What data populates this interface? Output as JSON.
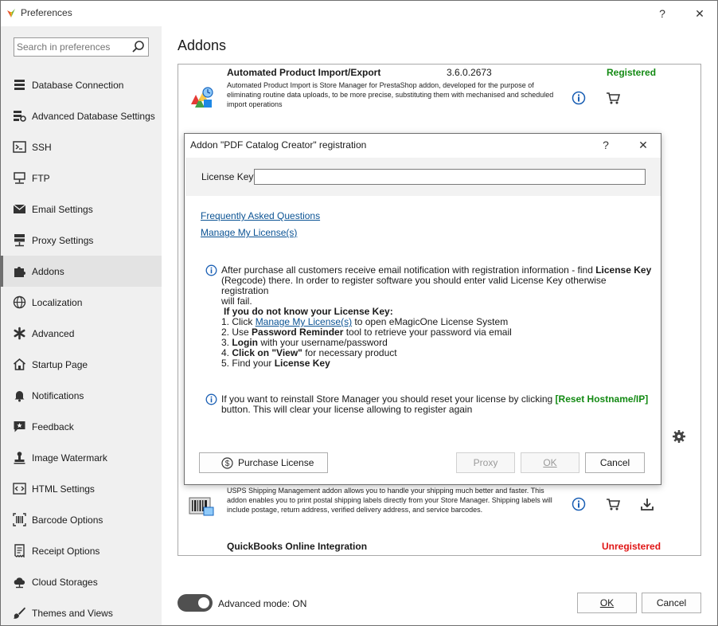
{
  "window": {
    "title": "Preferences",
    "help_glyph": "?",
    "close_glyph": "✕"
  },
  "sidebar": {
    "search_placeholder": "Search in preferences",
    "items": [
      {
        "label": "Database Connection",
        "icon": "database-icon"
      },
      {
        "label": "Advanced Database Settings",
        "icon": "database-settings-icon"
      },
      {
        "label": "SSH",
        "icon": "terminal-icon"
      },
      {
        "label": "FTP",
        "icon": "ftp-icon"
      },
      {
        "label": "Email Settings",
        "icon": "envelope-icon"
      },
      {
        "label": "Proxy Settings",
        "icon": "proxy-icon"
      },
      {
        "label": "Addons",
        "icon": "puzzle-icon",
        "active": true
      },
      {
        "label": "Localization",
        "icon": "globe-icon"
      },
      {
        "label": "Advanced",
        "icon": "asterisk-icon"
      },
      {
        "label": "Startup Page",
        "icon": "home-icon"
      },
      {
        "label": "Notifications",
        "icon": "bell-icon"
      },
      {
        "label": "Feedback",
        "icon": "feedback-icon"
      },
      {
        "label": "Image Watermark",
        "icon": "stamp-icon"
      },
      {
        "label": "HTML Settings",
        "icon": "code-icon"
      },
      {
        "label": "Barcode Options",
        "icon": "barcode-icon"
      },
      {
        "label": "Receipt Options",
        "icon": "receipt-icon"
      },
      {
        "label": "Cloud Storages",
        "icon": "cloud-icon"
      },
      {
        "label": "Themes and Views",
        "icon": "brush-icon"
      }
    ]
  },
  "main": {
    "title": "Addons",
    "addons": [
      {
        "name": "Automated Product Import/Export",
        "version": "3.6.0.2673",
        "status": "Registered",
        "description": "Automated Product Import is Store Manager for PrestaShop addon, developed for the purpose of eliminating routine data uploads, to be more precise, substituting them with mechanised and scheduled import operations"
      },
      {
        "name": "",
        "version": "",
        "status": "",
        "description": "USPS Shipping Management addon allows you to handle your shipping much better and faster. This addon enables you to print postal shipping labels directly from your Store Manager. Shipping labels will include postage, return address, verified delivery address, and service barcodes."
      },
      {
        "name": "QuickBooks Online Integration",
        "version": "",
        "status": "Unregistered",
        "description": ""
      }
    ],
    "advanced_mode_label": "Advanced mode: ON",
    "advanced_mode_on": true,
    "ok_label": "OK",
    "cancel_label": "Cancel"
  },
  "dialog": {
    "title": "Addon \"PDF Catalog Creator\" registration",
    "help_glyph": "?",
    "close_glyph": "✕",
    "license_label": "License Key*",
    "license_value": "",
    "links": {
      "faq": "Frequently Asked Questions",
      "manage": "Manage My License(s)"
    },
    "info1": {
      "line1_a": "After purchase all customers receive email notification with registration information - find ",
      "line1_b": "License Key",
      "line2": "(Regcode) there. In order to register software you should enter valid License Key otherwise registration",
      "line3": "will fail."
    },
    "steps": {
      "heading": "If you do not know your License Key:",
      "s1_a": "1. Click ",
      "s1_link": "Manage My License(s)",
      "s1_b": " to open eMagicOne License System",
      "s2_a": "2. Use ",
      "s2_b": "Password Reminder",
      "s2_c": " tool to retrieve your password via email",
      "s3_a": "3. ",
      "s3_b": "Login",
      "s3_c": " with your username/password",
      "s4_a": "4. ",
      "s4_b": "Click on \"View\"",
      "s4_c": " for necessary product",
      "s5_a": "5. Find your ",
      "s5_b": "License Key"
    },
    "info2": {
      "line1_a": "If you want to reinstall Store Manager you should reset your license by clicking ",
      "line1_link": "[Reset Hostname/IP]",
      "line2": "button. This will clear your license allowing to register again"
    },
    "buttons": {
      "purchase": "Purchase License",
      "proxy": "Proxy",
      "ok": "OK",
      "cancel": "Cancel"
    }
  },
  "colors": {
    "registered": "#138a13",
    "unregistered": "#e01515",
    "link": "#0b5394",
    "accent_blue": "#1a5fb4"
  }
}
